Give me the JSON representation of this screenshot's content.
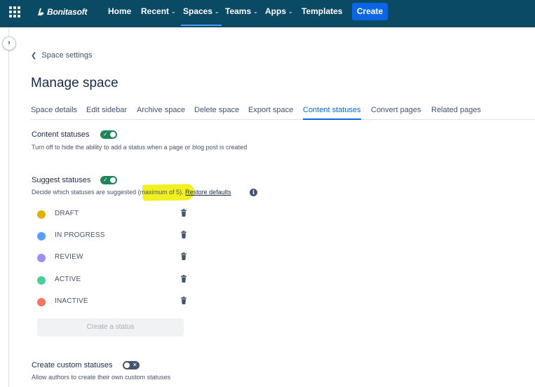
{
  "topnav": {
    "brand": "Bonitasoft",
    "items": [
      {
        "label": "Home",
        "has_menu": false
      },
      {
        "label": "Recent",
        "has_menu": true
      },
      {
        "label": "Spaces",
        "has_menu": true
      },
      {
        "label": "Teams",
        "has_menu": true
      },
      {
        "label": "Apps",
        "has_menu": true
      },
      {
        "label": "Templates",
        "has_menu": false
      }
    ],
    "create_label": "Create",
    "colors": {
      "background": "#0b4a64",
      "create": "#0c66e4"
    }
  },
  "breadcrumb": {
    "label": "Space settings"
  },
  "page": {
    "title": "Manage space"
  },
  "tabs": [
    {
      "label": "Space details"
    },
    {
      "label": "Edit sidebar"
    },
    {
      "label": "Archive space"
    },
    {
      "label": "Delete space"
    },
    {
      "label": "Export space"
    },
    {
      "label": "Content statuses",
      "active": true
    },
    {
      "label": "Convert pages"
    },
    {
      "label": "Related pages"
    }
  ],
  "content_statuses": {
    "label": "Content statuses",
    "enabled": true,
    "description": "Turn off to hide the ability to add a status when a page or blog post is created"
  },
  "suggest_statuses": {
    "label": "Suggest statuses",
    "enabled": true,
    "description_prefix": "Decide which statuses are suggested (maximum of 5).",
    "restore_label": "Restore defaults",
    "statuses": [
      {
        "name": "DRAFT",
        "color": "#e2b203"
      },
      {
        "name": "IN PROGRESS",
        "color": "#579dff"
      },
      {
        "name": "REVIEW",
        "color": "#9f8fef"
      },
      {
        "name": "ACTIVE",
        "color": "#4bce97"
      },
      {
        "name": "INACTIVE",
        "color": "#f87462"
      }
    ],
    "create_status_label": "Create a status"
  },
  "custom_statuses": {
    "label": "Create custom statuses",
    "enabled": false,
    "description": "Allow authors to create their own custom statuses"
  }
}
